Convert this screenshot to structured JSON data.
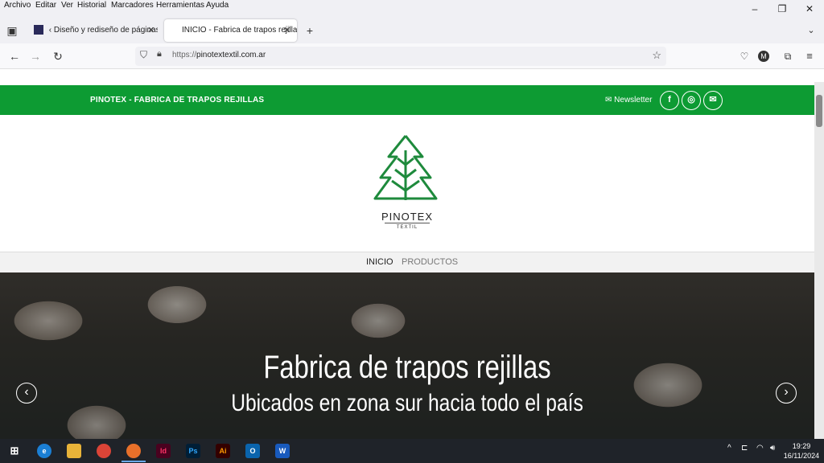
{
  "menubar": {
    "items": [
      "Archivo",
      "Editar",
      "Ver",
      "Historial",
      "Marcadores",
      "Herramientas",
      "Ayuda"
    ]
  },
  "tabs": [
    {
      "label": "‹ Diseño y rediseño de páginas",
      "active": false
    },
    {
      "label": "INICIO - Fabrica de trapos rejilla",
      "active": true
    }
  ],
  "url": {
    "protocol": "https://",
    "host": "pinotextextil.com.ar"
  },
  "site": {
    "brand": "PINOTEX - FABRICA DE TRAPOS REJILLAS",
    "newsletter": "Newsletter",
    "logo_name": "PINOTEX",
    "logo_sub": "TEXTIL",
    "menu": [
      {
        "label": "INICIO",
        "active": true
      },
      {
        "label": "PRODUCTOS",
        "active": false
      }
    ],
    "hero_title": "Fabrica de trapos rejillas",
    "hero_subtitle": "Ubicados en zona sur hacia todo el país"
  },
  "taskbar": {
    "apps": [
      "windows",
      "edge",
      "file-explorer",
      "chrome",
      "firefox",
      "indesign",
      "photoshop",
      "illustrator",
      "outlook",
      "word"
    ],
    "time": "19:29",
    "date": "16/11/2024"
  },
  "colors": {
    "green": "#0d9b33",
    "logo_green": "#1e8a3c"
  }
}
